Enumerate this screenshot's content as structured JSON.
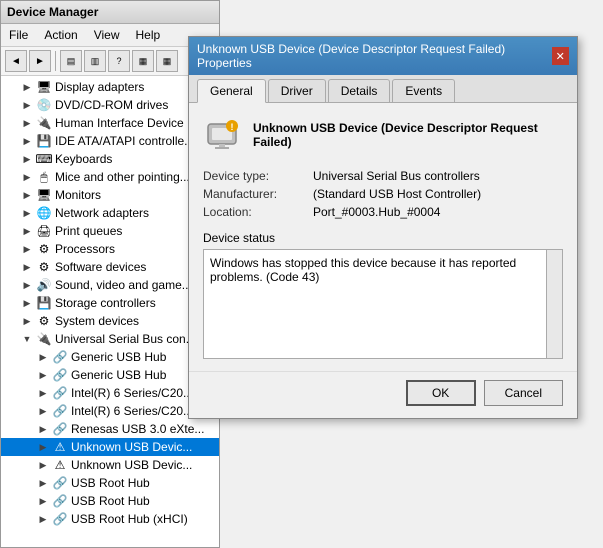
{
  "deviceManager": {
    "title": "Device Manager",
    "menuItems": [
      "File",
      "Action",
      "View",
      "Help"
    ],
    "treeItems": [
      {
        "id": "display",
        "label": "Display adapters",
        "indent": 1,
        "expanded": false,
        "icon": "monitor"
      },
      {
        "id": "dvd",
        "label": "DVD/CD-ROM drives",
        "indent": 1,
        "expanded": false,
        "icon": "disc"
      },
      {
        "id": "hid",
        "label": "Human Interface Device",
        "indent": 1,
        "expanded": false,
        "icon": "usb"
      },
      {
        "id": "ide",
        "label": "IDE ATA/ATAPI controlle...",
        "indent": 1,
        "expanded": false,
        "icon": "storage"
      },
      {
        "id": "keyboard",
        "label": "Keyboards",
        "indent": 1,
        "expanded": false,
        "icon": "keyboard"
      },
      {
        "id": "mice",
        "label": "Mice and other pointing...",
        "indent": 1,
        "expanded": false,
        "icon": "mouse"
      },
      {
        "id": "monitors",
        "label": "Monitors",
        "indent": 1,
        "expanded": false,
        "icon": "monitor2"
      },
      {
        "id": "network",
        "label": "Network adapters",
        "indent": 1,
        "expanded": false,
        "icon": "network"
      },
      {
        "id": "print",
        "label": "Print queues",
        "indent": 1,
        "expanded": false,
        "icon": "print"
      },
      {
        "id": "processor",
        "label": "Processors",
        "indent": 1,
        "expanded": false,
        "icon": "cpu"
      },
      {
        "id": "software",
        "label": "Software devices",
        "indent": 1,
        "expanded": false,
        "icon": "soft"
      },
      {
        "id": "sound",
        "label": "Sound, video and game...",
        "indent": 1,
        "expanded": false,
        "icon": "sound"
      },
      {
        "id": "storage",
        "label": "Storage controllers",
        "indent": 1,
        "expanded": false,
        "icon": "storage"
      },
      {
        "id": "system",
        "label": "System devices",
        "indent": 1,
        "expanded": false,
        "icon": "system"
      },
      {
        "id": "usb",
        "label": "Universal Serial Bus con...",
        "indent": 1,
        "expanded": true,
        "icon": "usb2"
      },
      {
        "id": "hub1",
        "label": "Generic USB Hub",
        "indent": 2,
        "expanded": false,
        "icon": "hub"
      },
      {
        "id": "hub2",
        "label": "Generic USB Hub",
        "indent": 2,
        "expanded": false,
        "icon": "hub"
      },
      {
        "id": "intel1",
        "label": "Intel(R) 6 Series/C20...",
        "indent": 2,
        "expanded": false,
        "icon": "hub"
      },
      {
        "id": "intel2",
        "label": "Intel(R) 6 Series/C20...",
        "indent": 2,
        "expanded": false,
        "icon": "hub"
      },
      {
        "id": "renesas",
        "label": "Renesas USB 3.0 eXte...",
        "indent": 2,
        "expanded": false,
        "icon": "hub"
      },
      {
        "id": "unknown1",
        "label": "Unknown USB Devic...",
        "indent": 2,
        "expanded": false,
        "icon": "warn",
        "selected": true
      },
      {
        "id": "unknown2",
        "label": "Unknown USB Devic...",
        "indent": 2,
        "expanded": false,
        "icon": "warn"
      },
      {
        "id": "root1",
        "label": "USB Root Hub",
        "indent": 2,
        "expanded": false,
        "icon": "hub"
      },
      {
        "id": "root2",
        "label": "USB Root Hub",
        "indent": 2,
        "expanded": false,
        "icon": "hub"
      },
      {
        "id": "root3",
        "label": "USB Root Hub (xHCI)",
        "indent": 2,
        "expanded": false,
        "icon": "hub"
      }
    ]
  },
  "dialog": {
    "title": "Unknown USB Device (Device Descriptor Request Failed) Properties",
    "tabs": [
      "General",
      "Driver",
      "Details",
      "Events"
    ],
    "activeTab": "General",
    "deviceName": "Unknown USB Device (Device Descriptor Request Failed)",
    "fields": {
      "deviceType": {
        "label": "Device type:",
        "value": "Universal Serial Bus controllers"
      },
      "manufacturer": {
        "label": "Manufacturer:",
        "value": "(Standard USB Host Controller)"
      },
      "location": {
        "label": "Location:",
        "value": "Port_#0003.Hub_#0004"
      }
    },
    "deviceStatusLabel": "Device status",
    "deviceStatusText": "Windows has stopped this device because it has reported problems. (Code 43)",
    "buttons": {
      "ok": "OK",
      "cancel": "Cancel"
    }
  }
}
